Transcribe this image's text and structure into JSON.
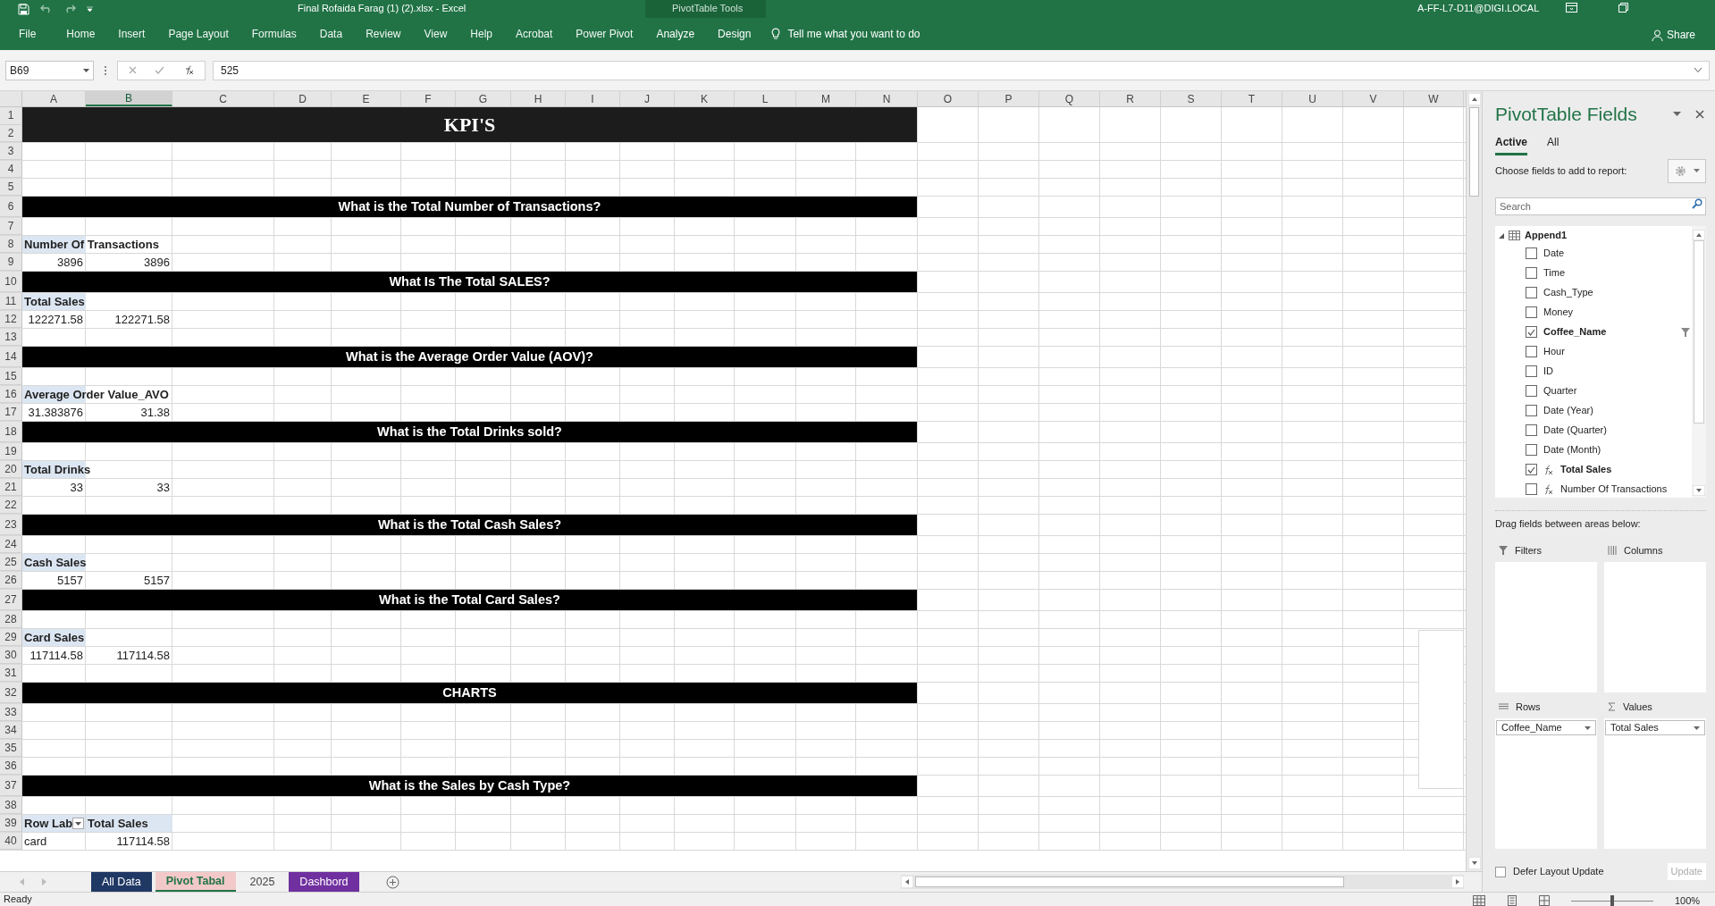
{
  "title_bar": {
    "title": "Final Rofaida Farag (1) (2).xlsx  -  Excel",
    "context_label": "PivotTable Tools",
    "user": "A-FF-L7-D11@DIGI.LOCAL"
  },
  "ribbon_tabs": [
    {
      "label": "File",
      "kind": "normal"
    },
    {
      "label": "Home",
      "kind": "normal"
    },
    {
      "label": "Insert",
      "kind": "normal"
    },
    {
      "label": "Page Layout",
      "kind": "normal"
    },
    {
      "label": "Formulas",
      "kind": "normal"
    },
    {
      "label": "Data",
      "kind": "normal"
    },
    {
      "label": "Review",
      "kind": "normal"
    },
    {
      "label": "View",
      "kind": "normal"
    },
    {
      "label": "Help",
      "kind": "normal"
    },
    {
      "label": "Acrobat",
      "kind": "normal"
    },
    {
      "label": "Power Pivot",
      "kind": "normal"
    },
    {
      "label": "Analyze",
      "kind": "contextual"
    },
    {
      "label": "Design",
      "kind": "contextual"
    }
  ],
  "tell_me": "Tell me what you want to do",
  "share": "Share",
  "formula_bar": {
    "name_box": "B69",
    "value": "525"
  },
  "sheet": {
    "columns": [
      {
        "letter": "A",
        "selected": false
      },
      {
        "letter": "B",
        "selected": true
      },
      {
        "letter": "C",
        "selected": false
      },
      {
        "letter": "D",
        "selected": false
      },
      {
        "letter": "E",
        "selected": false
      },
      {
        "letter": "F",
        "selected": false
      },
      {
        "letter": "G",
        "selected": false
      },
      {
        "letter": "H",
        "selected": false
      },
      {
        "letter": "I",
        "selected": false
      },
      {
        "letter": "J",
        "selected": false
      },
      {
        "letter": "K",
        "selected": false
      },
      {
        "letter": "L",
        "selected": false
      },
      {
        "letter": "M",
        "selected": false
      },
      {
        "letter": "N",
        "selected": false
      },
      {
        "letter": "O",
        "selected": false
      },
      {
        "letter": "P",
        "selected": false
      },
      {
        "letter": "Q",
        "selected": false
      },
      {
        "letter": "R",
        "selected": false
      },
      {
        "letter": "S",
        "selected": false
      },
      {
        "letter": "T",
        "selected": false
      },
      {
        "letter": "U",
        "selected": false
      },
      {
        "letter": "V",
        "selected": false
      },
      {
        "letter": "W",
        "selected": false
      }
    ],
    "rows": [
      {
        "kind": "title",
        "numbers": [
          "1",
          "2"
        ],
        "text": "KPI'S"
      },
      {
        "kind": "plain",
        "number": "3"
      },
      {
        "kind": "plain",
        "number": "4"
      },
      {
        "kind": "plain",
        "number": "5"
      },
      {
        "kind": "section",
        "number": "6",
        "text": "What is the Total Number of Transactions?"
      },
      {
        "kind": "plain",
        "number": "7"
      },
      {
        "kind": "plain",
        "number": "8",
        "column_a": {
          "kind": "label",
          "text": "Number Of Transactions"
        }
      },
      {
        "kind": "plain",
        "number": "9",
        "column_a": {
          "kind": "number",
          "text": "3896"
        },
        "column_b": {
          "kind": "number",
          "text": "3896"
        }
      },
      {
        "kind": "section",
        "number": "10",
        "text": "What Is The Total SALES?"
      },
      {
        "kind": "plain",
        "number": "11",
        "column_a": {
          "kind": "label",
          "text": "Total Sales"
        }
      },
      {
        "kind": "plain",
        "number": "12",
        "column_a": {
          "kind": "number",
          "text": "122271.58"
        },
        "column_b": {
          "kind": "number",
          "text": "122271.58"
        }
      },
      {
        "kind": "plain",
        "number": "13"
      },
      {
        "kind": "section",
        "number": "14",
        "text": "What is the Average Order Value (AOV)?"
      },
      {
        "kind": "plain",
        "number": "15"
      },
      {
        "kind": "plain",
        "number": "16",
        "column_a": {
          "kind": "label",
          "text": "Average Order Value_AVO"
        }
      },
      {
        "kind": "plain",
        "number": "17",
        "column_a": {
          "kind": "number",
          "text": "31.383876"
        },
        "column_b": {
          "kind": "number",
          "text": "31.38"
        }
      },
      {
        "kind": "section",
        "number": "18",
        "text": "What is the Total Drinks sold?"
      },
      {
        "kind": "plain",
        "number": "19"
      },
      {
        "kind": "plain",
        "number": "20",
        "column_a": {
          "kind": "label",
          "text": "Total Drinks"
        }
      },
      {
        "kind": "plain",
        "number": "21",
        "column_a": {
          "kind": "number",
          "text": "33"
        },
        "column_b": {
          "kind": "number",
          "text": "33"
        }
      },
      {
        "kind": "plain",
        "number": "22"
      },
      {
        "kind": "section",
        "number": "23",
        "text": "What is the Total Cash Sales?"
      },
      {
        "kind": "plain",
        "number": "24"
      },
      {
        "kind": "plain",
        "number": "25",
        "column_a": {
          "kind": "label",
          "text": "Cash Sales"
        }
      },
      {
        "kind": "plain",
        "number": "26",
        "column_a": {
          "kind": "number",
          "text": "5157"
        },
        "column_b": {
          "kind": "number",
          "text": "5157"
        }
      },
      {
        "kind": "section",
        "number": "27",
        "text": "What is the Total Card Sales?"
      },
      {
        "kind": "plain",
        "number": "28"
      },
      {
        "kind": "plain",
        "number": "29",
        "column_a": {
          "kind": "label",
          "text": "Card Sales"
        }
      },
      {
        "kind": "plain",
        "number": "30",
        "column_a": {
          "kind": "number",
          "text": "117114.58"
        },
        "column_b": {
          "kind": "number",
          "text": "117114.58"
        }
      },
      {
        "kind": "plain",
        "number": "31"
      },
      {
        "kind": "section",
        "number": "32",
        "text": "CHARTS"
      },
      {
        "kind": "plain",
        "number": "33"
      },
      {
        "kind": "plain",
        "number": "34"
      },
      {
        "kind": "plain",
        "number": "35"
      },
      {
        "kind": "plain",
        "number": "36"
      },
      {
        "kind": "section",
        "number": "37",
        "text": "What is the Sales by Cash Type?"
      },
      {
        "kind": "plain",
        "number": "38"
      },
      {
        "kind": "plain",
        "number": "39",
        "column_a": {
          "kind": "pivot-label",
          "text": "Row Lab"
        },
        "column_b": {
          "kind": "label",
          "text": "Total Sales"
        }
      },
      {
        "kind": "plain",
        "number": "40",
        "column_a": {
          "kind": "text",
          "text": "card"
        },
        "column_b": {
          "kind": "number",
          "text": "117114.58"
        }
      }
    ]
  },
  "sheet_tabs": [
    {
      "label": "All Data",
      "selected": false,
      "color": "#203864"
    },
    {
      "label": "Pivot Tabal",
      "selected": true,
      "color": "#f2c9c8"
    },
    {
      "label": "2025",
      "selected": false
    },
    {
      "label": "Dashbord",
      "selected": false,
      "color": "#7030a0"
    }
  ],
  "status_bar": {
    "text": "Ready",
    "zoom": "100%",
    "zoom_slider": {
      "level": 0.5
    }
  },
  "pivot_panel": {
    "title": "PivotTable Fields",
    "tabs": [
      {
        "label": "Active",
        "selected": true
      },
      {
        "label": "All",
        "selected": false
      }
    ],
    "choose_label": "Choose fields to add to report:",
    "search": {
      "placeholder": "Search"
    },
    "table": {
      "name": "Append1",
      "expanded": true,
      "fields": [
        {
          "label": "Date",
          "checked": false,
          "kind": "field",
          "filtered": false
        },
        {
          "label": "Time",
          "checked": false,
          "kind": "field",
          "filtered": false
        },
        {
          "label": "Cash_Type",
          "checked": false,
          "kind": "field",
          "filtered": false
        },
        {
          "label": "Money",
          "checked": false,
          "kind": "field",
          "filtered": false
        },
        {
          "label": "Coffee_Name",
          "checked": true,
          "kind": "field",
          "filtered": true
        },
        {
          "label": "Hour",
          "checked": false,
          "kind": "field",
          "filtered": false
        },
        {
          "label": "ID",
          "checked": false,
          "kind": "field",
          "filtered": false
        },
        {
          "label": "Quarter",
          "checked": false,
          "kind": "field",
          "filtered": false
        },
        {
          "label": "Date (Year)",
          "checked": false,
          "kind": "field",
          "filtered": false
        },
        {
          "label": "Date (Quarter)",
          "checked": false,
          "kind": "field",
          "filtered": false
        },
        {
          "label": "Date (Month)",
          "checked": false,
          "kind": "field",
          "filtered": false
        },
        {
          "label": "Total Sales",
          "checked": true,
          "kind": "measure",
          "filtered": false
        },
        {
          "label": "Number Of Transactions",
          "checked": false,
          "kind": "measure",
          "filtered": false
        }
      ]
    },
    "drag_label": "Drag fields between areas below:",
    "areas": [
      {
        "kind": "filters",
        "label": "Filters"
      },
      {
        "kind": "columns",
        "label": "Columns"
      },
      {
        "kind": "rows",
        "label": "Rows",
        "items": [
          "Coffee_Name"
        ]
      },
      {
        "kind": "values",
        "label": "Values",
        "items": [
          "Total Sales"
        ]
      }
    ],
    "defer": {
      "label": "Defer Layout Update",
      "checked": false
    },
    "update_button": {
      "label": "Update",
      "disabled": true
    }
  }
}
